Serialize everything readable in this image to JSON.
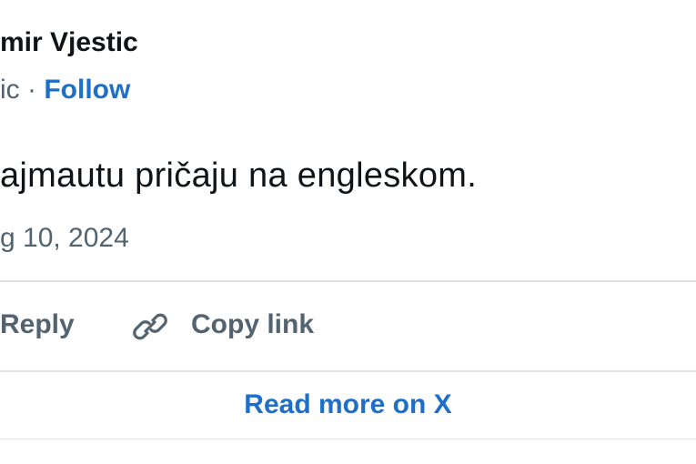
{
  "tweet": {
    "author_name": "mir Vjestic",
    "handle_fragment": "ic",
    "separator": " · ",
    "follow_label": "Follow",
    "text": "ajmautu pričaju na engleskom.",
    "date": "g 10, 2024"
  },
  "actions": {
    "reply_label": "Reply",
    "copy_link_label": "Copy link",
    "copy_link_icon": "link-icon"
  },
  "footer": {
    "read_more_label": "Read more on X"
  },
  "colors": {
    "text": "#0f1419",
    "muted": "#536471",
    "link": "#1d6fc8",
    "divider": "#dfe3e7"
  }
}
